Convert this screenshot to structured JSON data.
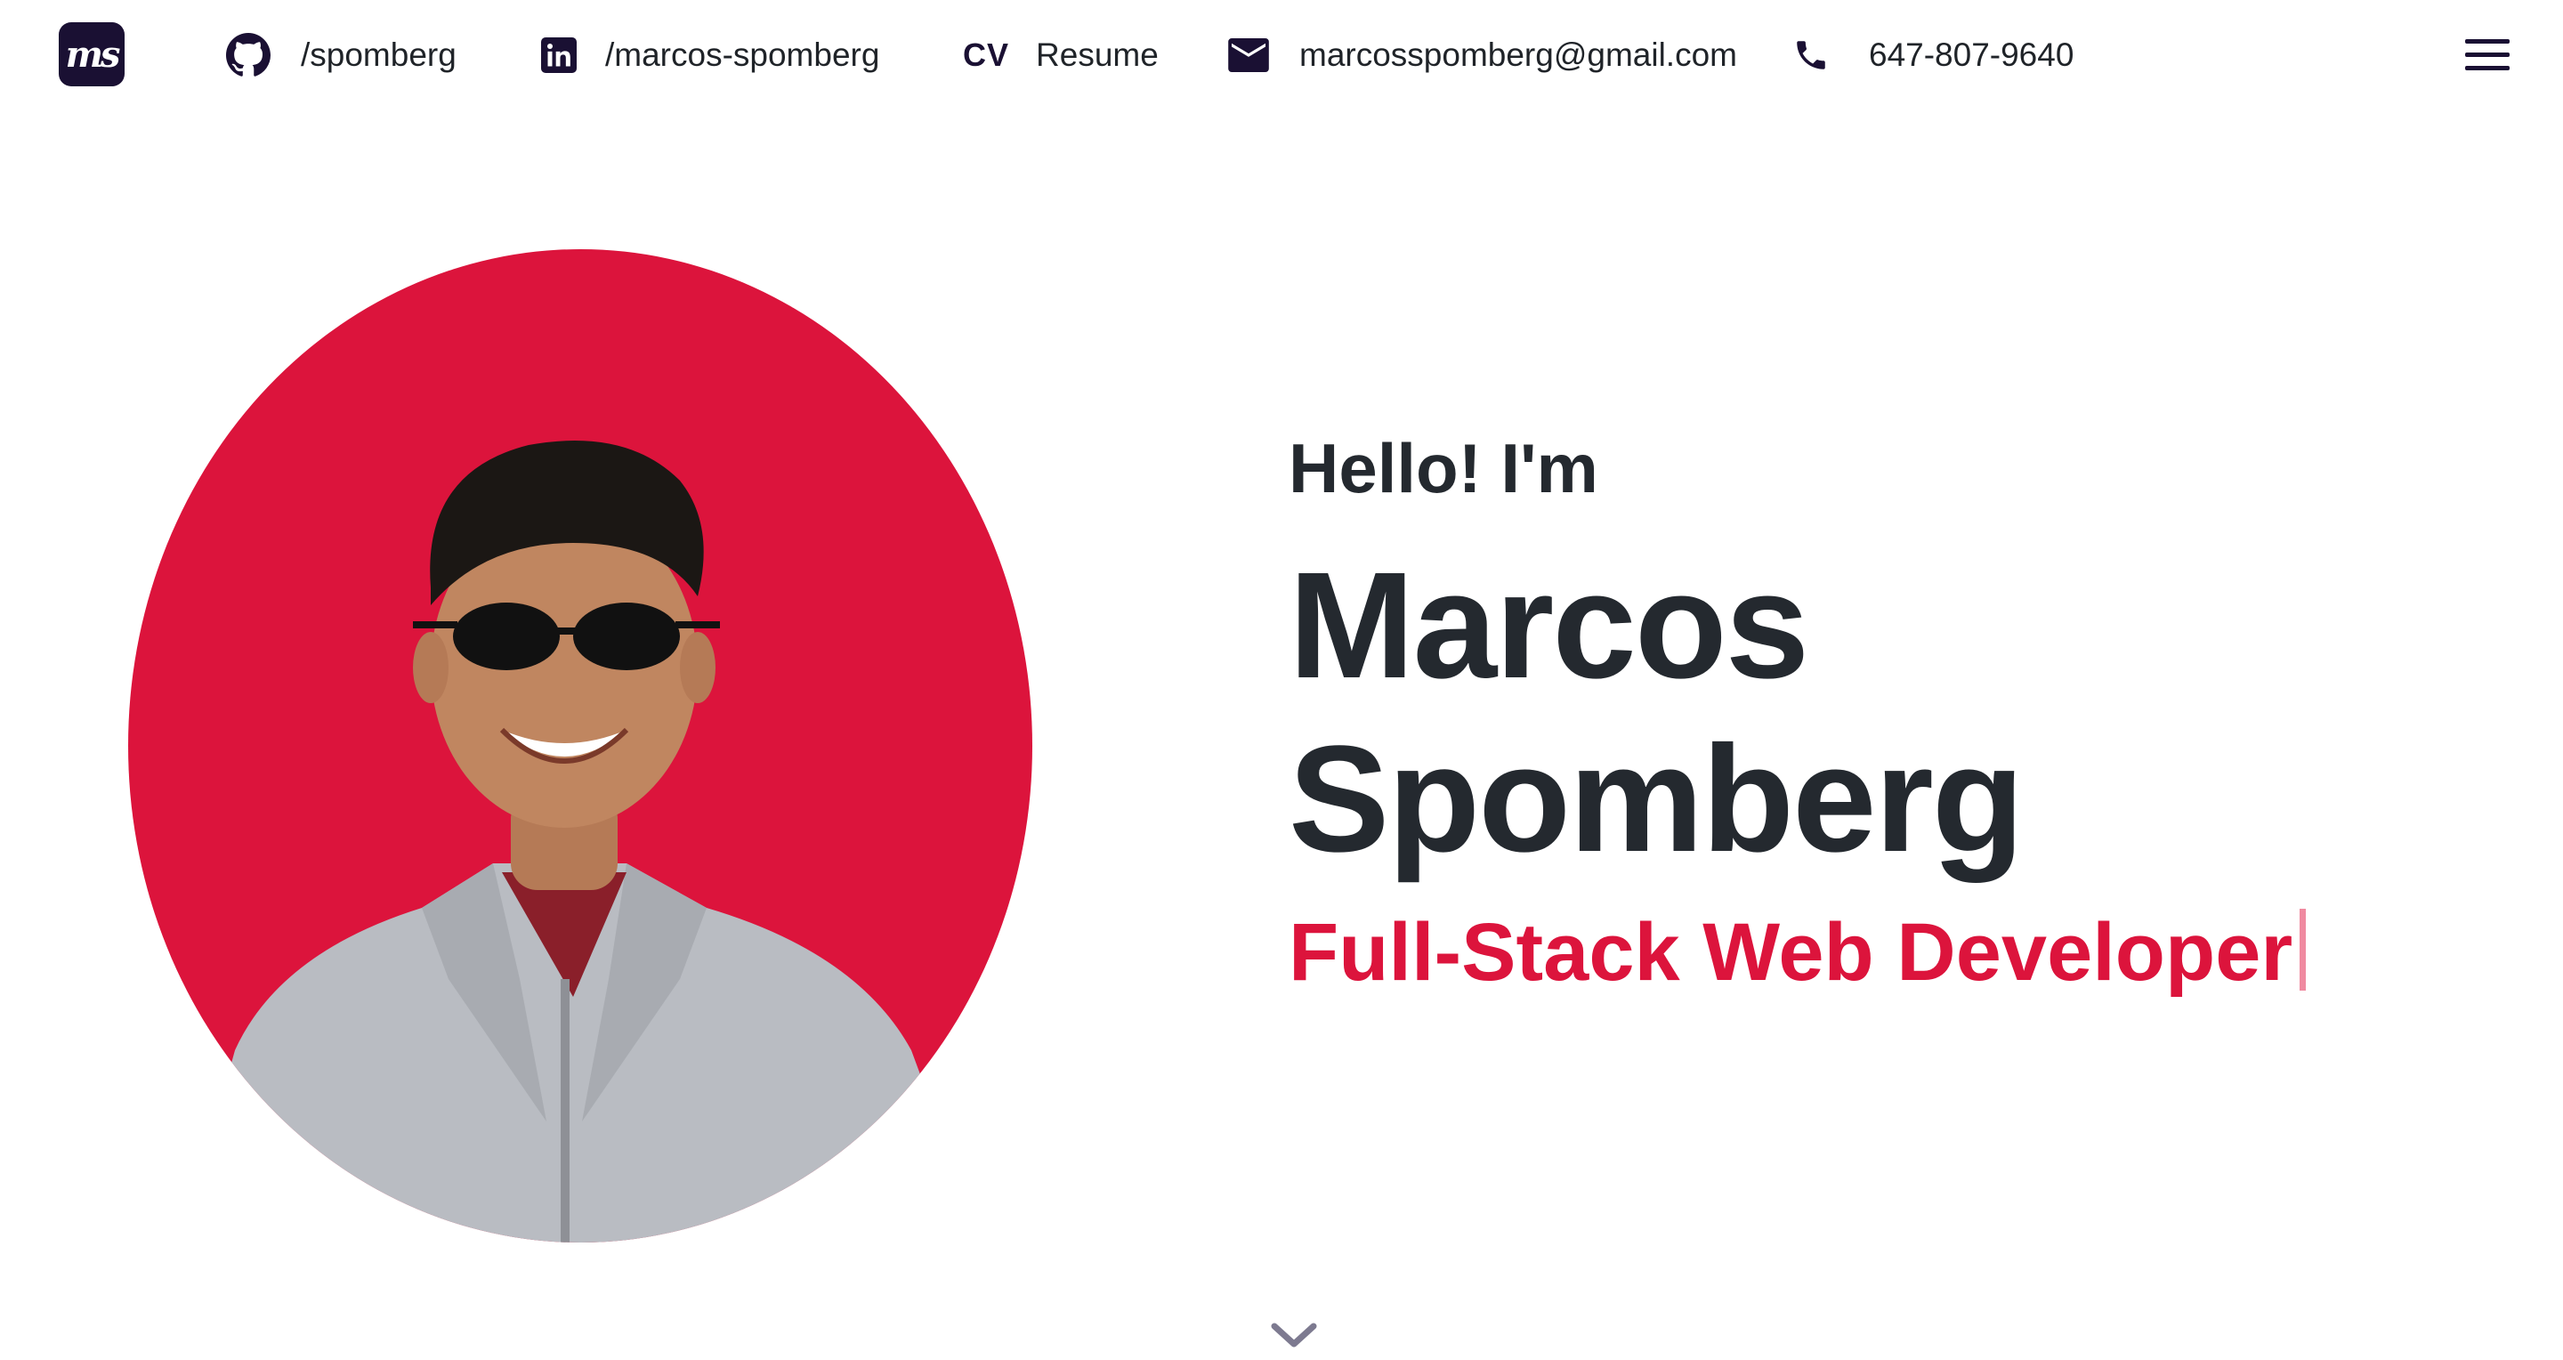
{
  "header": {
    "logo_text": "ms",
    "links": {
      "github": {
        "icon": "github-icon",
        "label": "/spomberg"
      },
      "linkedin": {
        "icon": "linkedin-icon",
        "label": "/marcos-spomberg"
      },
      "resume": {
        "badge": "CV",
        "label": "Resume"
      },
      "email": {
        "icon": "mail-icon",
        "label": "marcosspomberg@gmail.com"
      },
      "phone": {
        "icon": "phone-icon",
        "label": "647-807-9640"
      }
    },
    "menu_icon": "hamburger-menu-icon"
  },
  "hero": {
    "greeting": "Hello! I'm",
    "name_first": "Marcos",
    "name_last": "Spomberg",
    "role": "Full-Stack Web Developer",
    "scroll_icon": "chevron-down-icon"
  },
  "colors": {
    "accent": "#dc143c",
    "brand_dark": "#1a1033",
    "text": "#24292f",
    "background": "#ffffff"
  }
}
